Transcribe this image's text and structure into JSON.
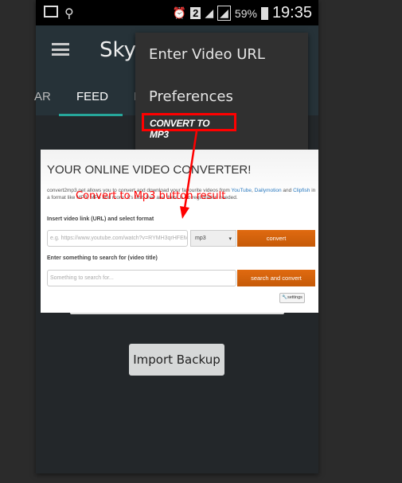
{
  "status_bar": {
    "battery": "59%",
    "time": "19:35",
    "sim": "2"
  },
  "app_bar": {
    "title": "SkyT",
    "tabs": [
      "AR",
      "FEED",
      "I"
    ]
  },
  "menu": {
    "items": [
      "Enter Video URL",
      "Preferences"
    ],
    "highlighted": "CONVERT TO MP3"
  },
  "annotation": {
    "text": "Convert to Mp3 button result",
    "color": "#ff0000"
  },
  "converter": {
    "title": "YOUR ONLINE VIDEO CONVERTER!",
    "desc_pre": "convert2mp3.net allows you to convert and download your favourite videos from ",
    "links": [
      "YouTube",
      "Dailymotion",
      "Clipfish"
    ],
    "desc_and": " and ",
    "desc_post": " in a format like MP3, MP4 and more. It's fast, free and there is no registration needed.",
    "url_label": "Insert video link (URL) and select format",
    "url_placeholder": "e.g. https://www.youtube.com/watch?v=RYMH3qrHFEM",
    "format": "mp3",
    "convert": "convert",
    "search_label": "Enter something to search for (video title)",
    "search_placeholder": "Something to search for...",
    "search_convert": "search and convert",
    "settings": "settings"
  },
  "import_backup": "Import Backup",
  "colors": {
    "accent": "#26a69a",
    "appbar": "#263238",
    "convert_button": "#d2610c"
  }
}
